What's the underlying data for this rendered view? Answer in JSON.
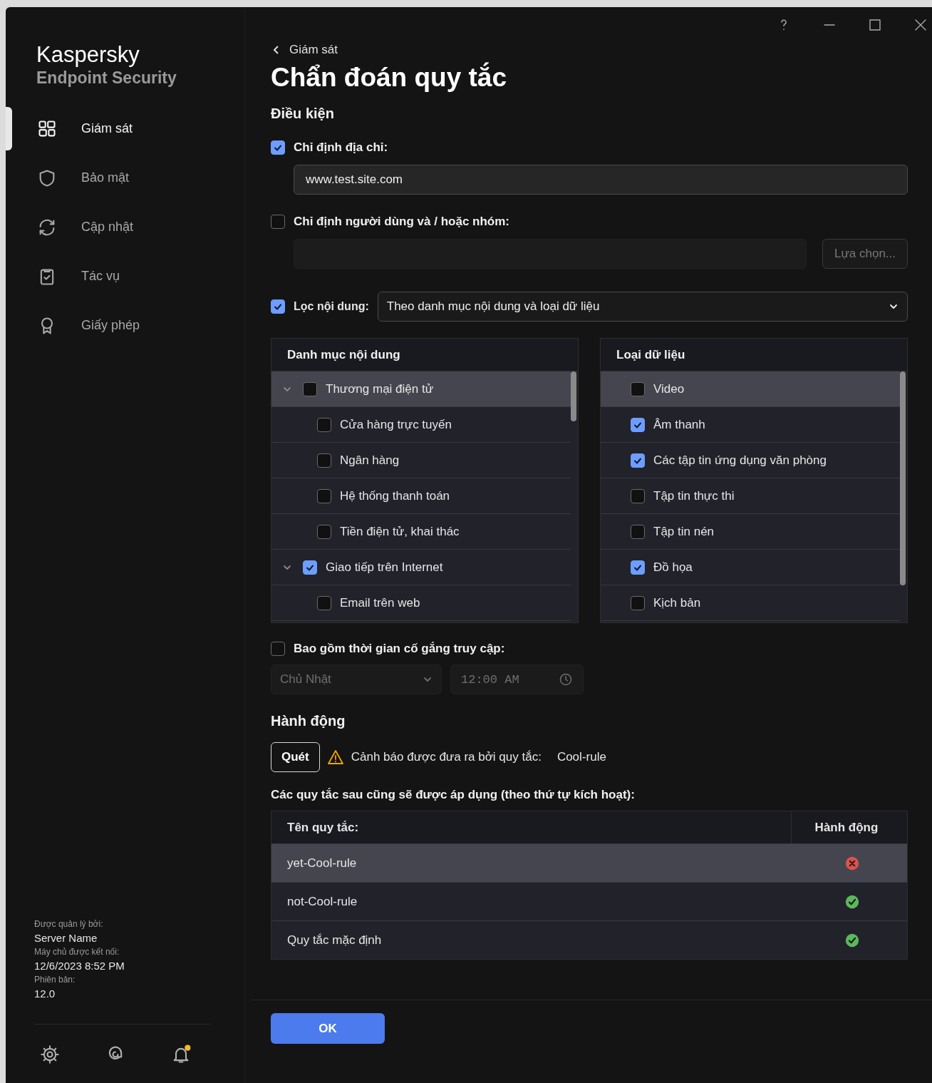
{
  "sidebar": {
    "brand": "Kaspersky",
    "product": "Endpoint Security",
    "items": [
      {
        "label": "Giám sát",
        "selected": true
      },
      {
        "label": "Bảo mật",
        "selected": false
      },
      {
        "label": "Cập nhật",
        "selected": false
      },
      {
        "label": "Tác vụ",
        "selected": false
      },
      {
        "label": "Giấy phép",
        "selected": false
      }
    ],
    "info": [
      {
        "label": "Được quản lý bởi:",
        "value": "Server Name"
      },
      {
        "label": "Máy chủ được kết nối:",
        "value": "12/6/2023 8:52 PM"
      },
      {
        "label": "Phiên bản:",
        "value": "12.0"
      }
    ]
  },
  "breadcrumb": "Giám sát",
  "title": "Chẩn đoán quy tắc",
  "conditions": {
    "heading": "Điều kiện",
    "address": {
      "label": "Chỉ định địa chỉ:",
      "checked": true,
      "value": "www.test.site.com"
    },
    "users": {
      "label": "Chỉ định người dùng và / hoặc nhóm:",
      "checked": false,
      "disabled": true,
      "button": "Lựa chọn..."
    },
    "content_filter": {
      "label": "Lọc nội dung:",
      "checked": true,
      "value": "Theo danh mục nội dung và loại dữ liệu"
    },
    "categories": {
      "heading": "Danh mục nội dung",
      "items": [
        {
          "label": "Thương mại điện tử",
          "checked": false,
          "expanded": true,
          "selected": true,
          "children": [
            {
              "label": "Cửa hàng trực tuyến",
              "checked": false,
              "selected": false
            },
            {
              "label": "Ngân hàng",
              "checked": false,
              "selected": false
            },
            {
              "label": "Hệ thống thanh toán",
              "checked": false,
              "selected": false
            },
            {
              "label": "Tiền điện tử, khai thác",
              "checked": false,
              "selected": false
            }
          ]
        },
        {
          "label": "Giao tiếp trên Internet",
          "checked": true,
          "expanded": true,
          "selected": false,
          "children": [
            {
              "label": "Email trên web",
              "checked": false,
              "selected": false
            }
          ]
        }
      ]
    },
    "data_types": {
      "heading": "Loại dữ liệu",
      "items": [
        {
          "label": "Video",
          "checked": false,
          "selected": true
        },
        {
          "label": "Âm thanh",
          "checked": true,
          "selected": false
        },
        {
          "label": "Các tập tin ứng dụng văn phòng",
          "checked": true,
          "selected": false
        },
        {
          "label": "Tập tin thực thi",
          "checked": false,
          "selected": false
        },
        {
          "label": "Tập tin nén",
          "checked": false,
          "selected": false
        },
        {
          "label": "Đồ họa",
          "checked": true,
          "selected": false
        },
        {
          "label": "Kịch bản",
          "checked": false,
          "selected": false
        }
      ]
    },
    "access_time": {
      "label": "Bao gồm thời gian cố gắng truy cập:",
      "checked": false,
      "disabled": true,
      "day": "Chủ Nhật",
      "time": "12:00 AM"
    }
  },
  "action": {
    "heading": "Hành động",
    "button": "Quét",
    "warning": "Cảnh báo được đưa ra bởi quy tắc:",
    "rule": "Cool-rule"
  },
  "rules": {
    "caption": "Các quy tắc sau cũng sẽ được áp dụng (theo thứ tự kích hoạt):",
    "columns": [
      "Tên quy tắc:",
      "Hành động"
    ],
    "rows": [
      {
        "name": "yet-Cool-rule",
        "kind": "blocked",
        "selected": true
      },
      {
        "name": "not-Cool-rule",
        "kind": "allowed",
        "selected": false
      },
      {
        "name": "Quy tắc mặc định",
        "kind": "allowed",
        "selected": false
      }
    ]
  },
  "ok_button": "OK"
}
